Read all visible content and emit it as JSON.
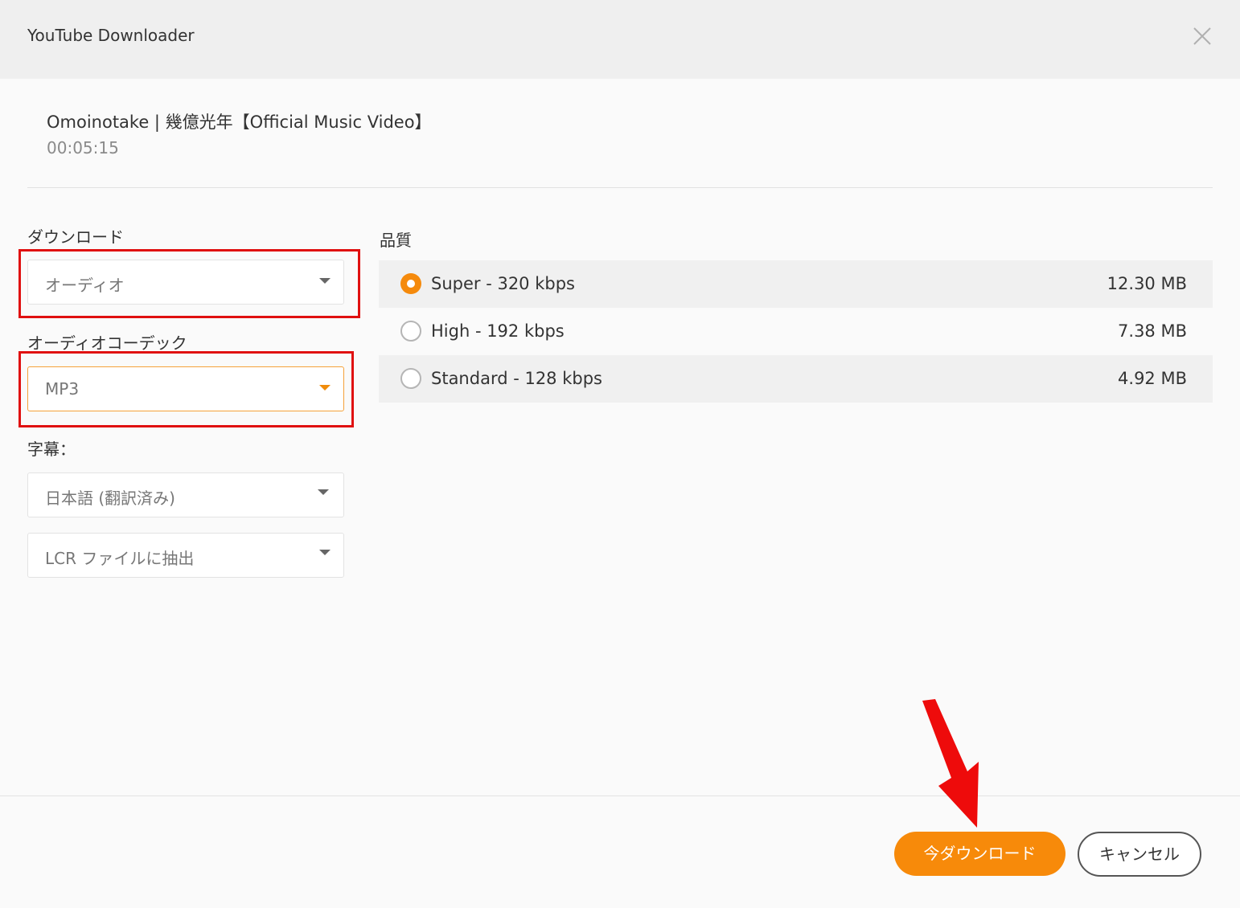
{
  "window": {
    "title": "YouTube Downloader",
    "close_icon": "close-icon"
  },
  "video": {
    "title": "Omoinotake | 幾億光年【Official Music Video】",
    "duration": "00:05:15"
  },
  "download": {
    "label": "ダウンロード",
    "selected": "オーディオ"
  },
  "codec": {
    "label": "オーディオコーデック",
    "selected": "MP3"
  },
  "subtitles": {
    "label": "字幕：",
    "language": "日本語 (翻訳済み)",
    "extract": "LCR ファイルに抽出"
  },
  "quality": {
    "label": "品質",
    "options": [
      {
        "label": "Super - 320 kbps",
        "size": "12.30 MB",
        "selected": true
      },
      {
        "label": "High - 192 kbps",
        "size": "7.38 MB",
        "selected": false
      },
      {
        "label": "Standard - 128 kbps",
        "size": "4.92 MB",
        "selected": false
      }
    ]
  },
  "footer": {
    "download_label": "今ダウンロード",
    "cancel_label": "キャンセル"
  },
  "colors": {
    "accent": "#f78a0a",
    "annotation_red": "#e01010",
    "titlebar_bg": "#efefef"
  }
}
